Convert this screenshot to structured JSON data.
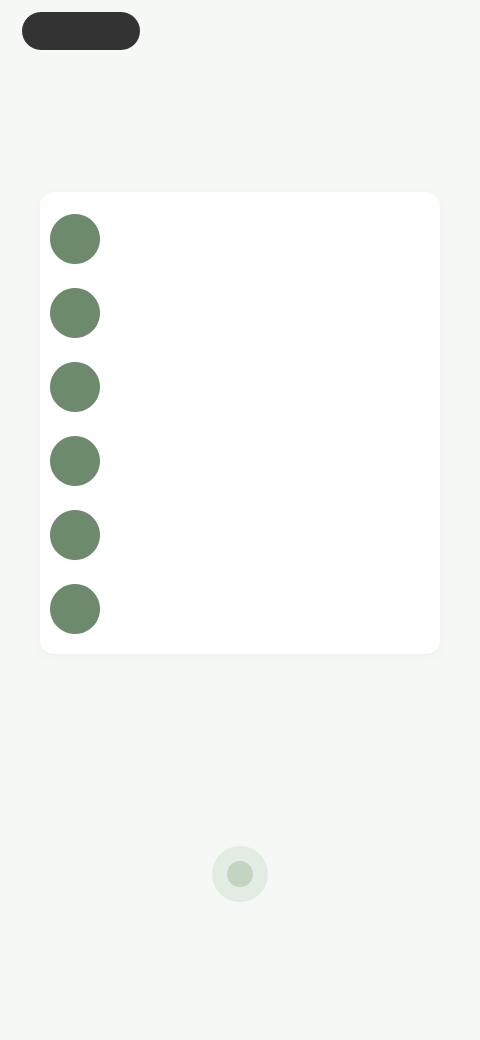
{
  "header": {
    "back_label": "",
    "right_text": ""
  },
  "title": "",
  "list": {
    "items": [
      {
        "icon": "step-circle-icon",
        "line1": "",
        "line2": ""
      },
      {
        "icon": "step-circle-icon",
        "line1": "",
        "line2": ""
      },
      {
        "icon": "step-circle-icon",
        "line1": "",
        "line2": ""
      },
      {
        "icon": "step-circle-icon",
        "line1": "",
        "line2": ""
      },
      {
        "icon": "step-circle-icon",
        "line1": "",
        "line2": ""
      },
      {
        "icon": "step-circle-icon",
        "line1": "",
        "line2": ""
      }
    ]
  },
  "footer": {
    "icon": "badge-icon",
    "text": ""
  },
  "colors": {
    "background": "#f6f8f6",
    "accent": "#6e8a6c",
    "pill": "#333333",
    "card": "#ffffff"
  }
}
